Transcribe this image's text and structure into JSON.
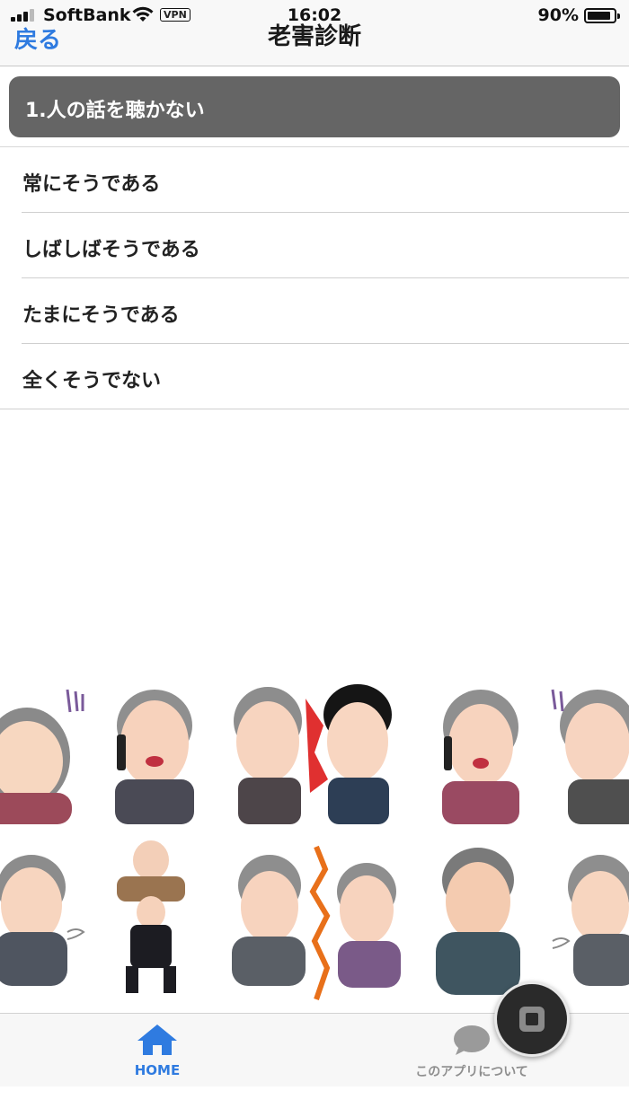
{
  "status_bar": {
    "carrier": "SoftBank",
    "vpn": "VPN",
    "time": "16:02",
    "battery_percent": "90%",
    "battery_level": 0.9
  },
  "nav": {
    "back_label": "戻る",
    "title": "老害診断"
  },
  "question": {
    "text": "1.人の話を聴かない"
  },
  "options": [
    {
      "label": "常にそうである"
    },
    {
      "label": "しばしばそうである"
    },
    {
      "label": "たまにそうである"
    },
    {
      "label": "全くそうでない"
    }
  ],
  "tab_bar": {
    "tabs": [
      {
        "label": "HOME",
        "icon": "home-icon",
        "active": true
      },
      {
        "label": "このアプリについて",
        "icon": "chat-bubble-icon",
        "active": false
      }
    ]
  },
  "colors": {
    "accent": "#2f7be0",
    "question_bg": "#656565",
    "inactive_tab": "#8e8e8e"
  }
}
